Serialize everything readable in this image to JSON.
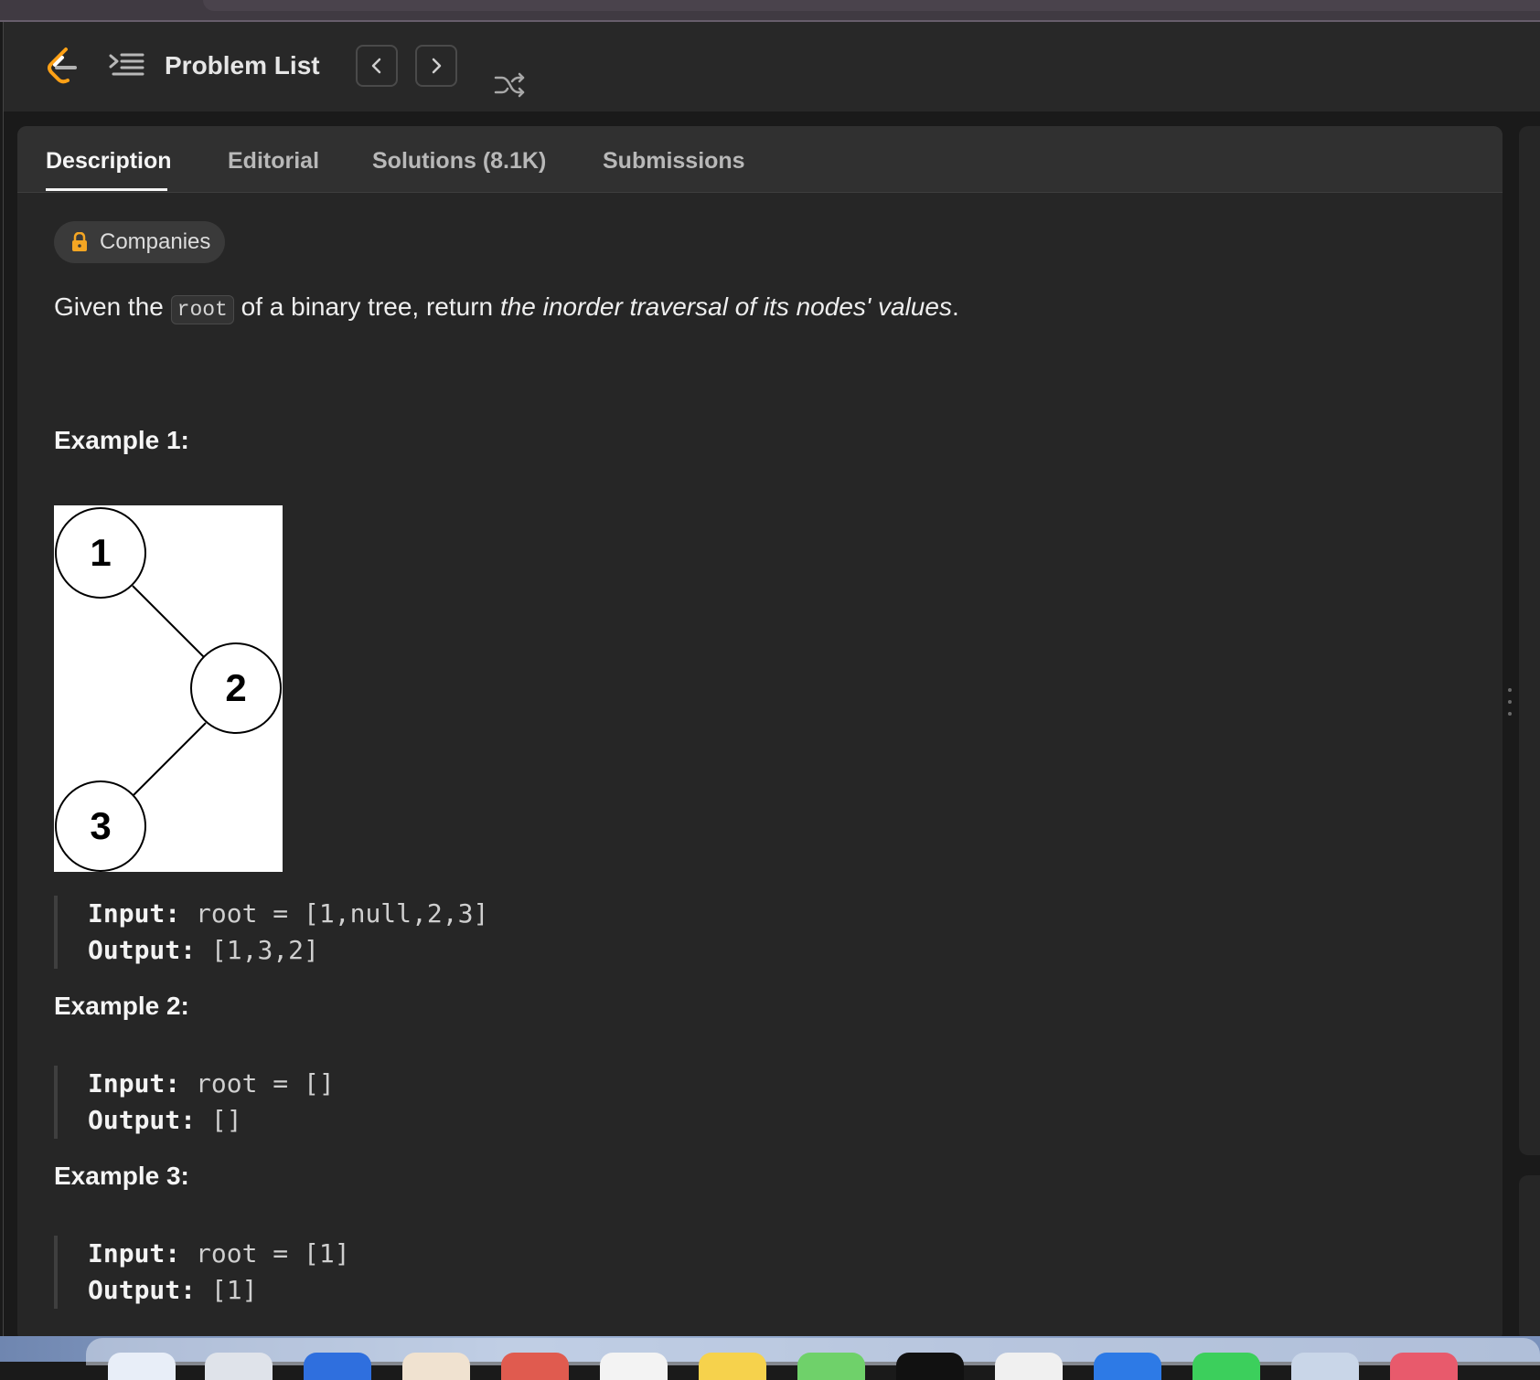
{
  "navbar": {
    "problem_list": "Problem List"
  },
  "tabs": [
    {
      "label": "Description",
      "active": true
    },
    {
      "label": "Editorial",
      "active": false
    },
    {
      "label": "Solutions (8.1K)",
      "active": false
    },
    {
      "label": "Submissions",
      "active": false
    }
  ],
  "companies_label": "Companies",
  "description": {
    "part1": "Given the ",
    "code": "root",
    "part2": " of a binary tree, return ",
    "emphasis": "the inorder traversal of its nodes' values",
    "part3": "."
  },
  "tree_nodes": [
    "1",
    "2",
    "3"
  ],
  "examples": [
    {
      "title": "Example 1:",
      "input_label": "Input:",
      "input": "root = [1,null,2,3]",
      "output_label": "Output:",
      "output": "[1,3,2]"
    },
    {
      "title": "Example 2:",
      "input_label": "Input:",
      "input": "root = []",
      "output_label": "Output:",
      "output": "[]"
    },
    {
      "title": "Example 3:",
      "input_label": "Input:",
      "input": "root = [1]",
      "output_label": "Output:",
      "output": "[1]"
    }
  ],
  "colors": {
    "accent_orange": "#f5a623",
    "background": "#1a1a1a",
    "panel": "#262626"
  },
  "icons": [
    "logo-icon",
    "problem-list-icon",
    "chevron-left-icon",
    "chevron-right-icon",
    "shuffle-icon",
    "lock-icon",
    "drag-handle-icon"
  ]
}
